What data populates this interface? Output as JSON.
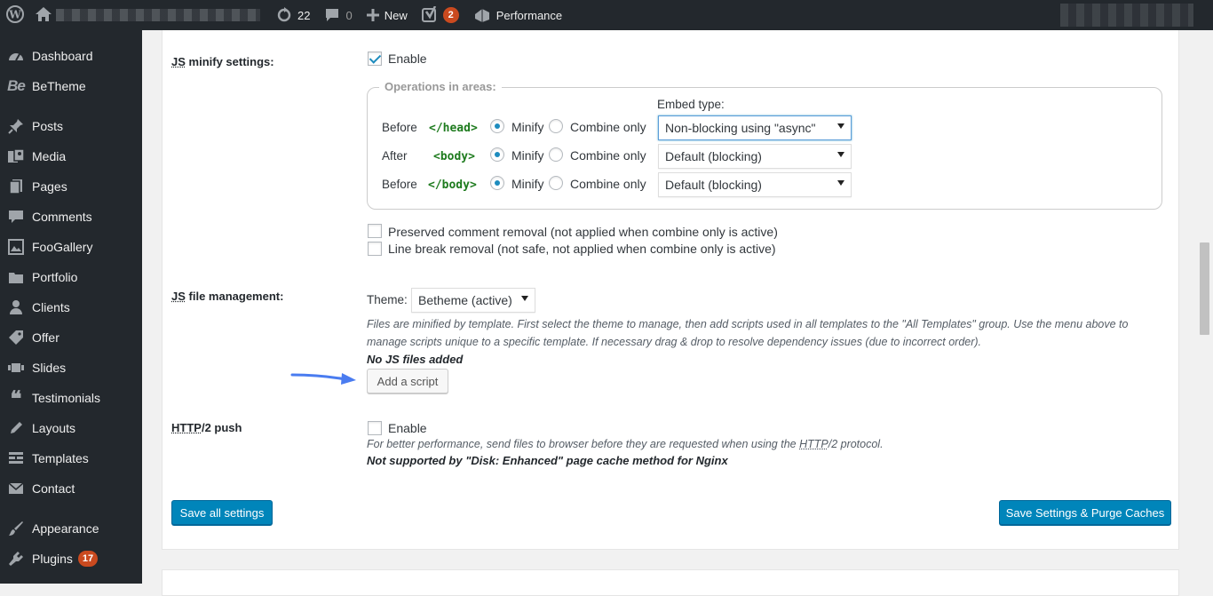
{
  "adminbar": {
    "updates_count": "22",
    "comments_count": "0",
    "new_label": "New",
    "yoast_badge": "2",
    "performance_label": "Performance"
  },
  "sidebar": {
    "items": [
      {
        "label": "Dashboard",
        "icon": "dashboard-icon"
      },
      {
        "label": "BeTheme",
        "icon": "betheme-logo",
        "logo_text": "Be"
      },
      {
        "label": "Posts",
        "icon": "pin-icon"
      },
      {
        "label": "Media",
        "icon": "media-icon"
      },
      {
        "label": "Pages",
        "icon": "pages-icon"
      },
      {
        "label": "Comments",
        "icon": "comments-icon"
      },
      {
        "label": "FooGallery",
        "icon": "gallery-icon"
      },
      {
        "label": "Portfolio",
        "icon": "portfolio-icon"
      },
      {
        "label": "Clients",
        "icon": "clients-icon"
      },
      {
        "label": "Offer",
        "icon": "tag-icon"
      },
      {
        "label": "Slides",
        "icon": "slides-icon"
      },
      {
        "label": "Testimonials",
        "icon": "quote-icon"
      },
      {
        "label": "Layouts",
        "icon": "edit-icon"
      },
      {
        "label": "Templates",
        "icon": "templates-icon"
      },
      {
        "label": "Contact",
        "icon": "mail-icon"
      },
      {
        "label": "Appearance",
        "icon": "appearance-icon"
      },
      {
        "label": "Plugins",
        "icon": "plugin-icon",
        "badge": "17"
      }
    ]
  },
  "js_minify": {
    "label_abbr": "JS",
    "label_rest": " minify settings:",
    "enable_label": "Enable",
    "operations_legend": "Operations in areas:",
    "embed_type_label": "Embed type:",
    "rows": [
      {
        "position": "Before",
        "tag": "</head>",
        "minify": "Minify",
        "combine": "Combine only",
        "embed": "Non-blocking using \"async\""
      },
      {
        "position": "After",
        "tag": "<body>",
        "minify": "Minify",
        "combine": "Combine only",
        "embed": "Default (blocking)"
      },
      {
        "position": "Before",
        "tag": "</body>",
        "minify": "Minify",
        "combine": "Combine only",
        "embed": "Default (blocking)"
      }
    ],
    "preserved_comment": "Preserved comment removal (not applied when combine only is active)",
    "line_break": "Line break removal (not safe, not applied when combine only is active)"
  },
  "js_file": {
    "label_abbr": "JS",
    "label_rest": " file management:",
    "theme_label": "Theme:",
    "theme_value": "Betheme (active)",
    "description_line1": "Files are minified by template. First select the theme to manage, then add scripts used in all templates to the \"All Templates\" group. Use the menu above to",
    "description_line2": "manage scripts unique to a specific template. If necessary drag & drop to resolve dependency issues (due to incorrect order).",
    "no_files": "No JS files added",
    "add_script": "Add a script"
  },
  "http2": {
    "label_abbr": "HTTP",
    "label_rest": "/2 push",
    "enable_label": "Enable",
    "desc_prefix": "For better performance, send files to browser before they are requested when using the ",
    "desc_abbr": "HTTP",
    "desc_suffix": "/2 protocol.",
    "note": "Not supported by \"Disk: Enhanced\" page cache method for Nginx"
  },
  "buttons": {
    "save_all": "Save all settings",
    "save_purge": "Save Settings & Purge Caches"
  },
  "colors": {
    "accent": "#0085ba",
    "tag_green": "#1e7b1e",
    "arrow_blue": "#4a7cf0"
  }
}
